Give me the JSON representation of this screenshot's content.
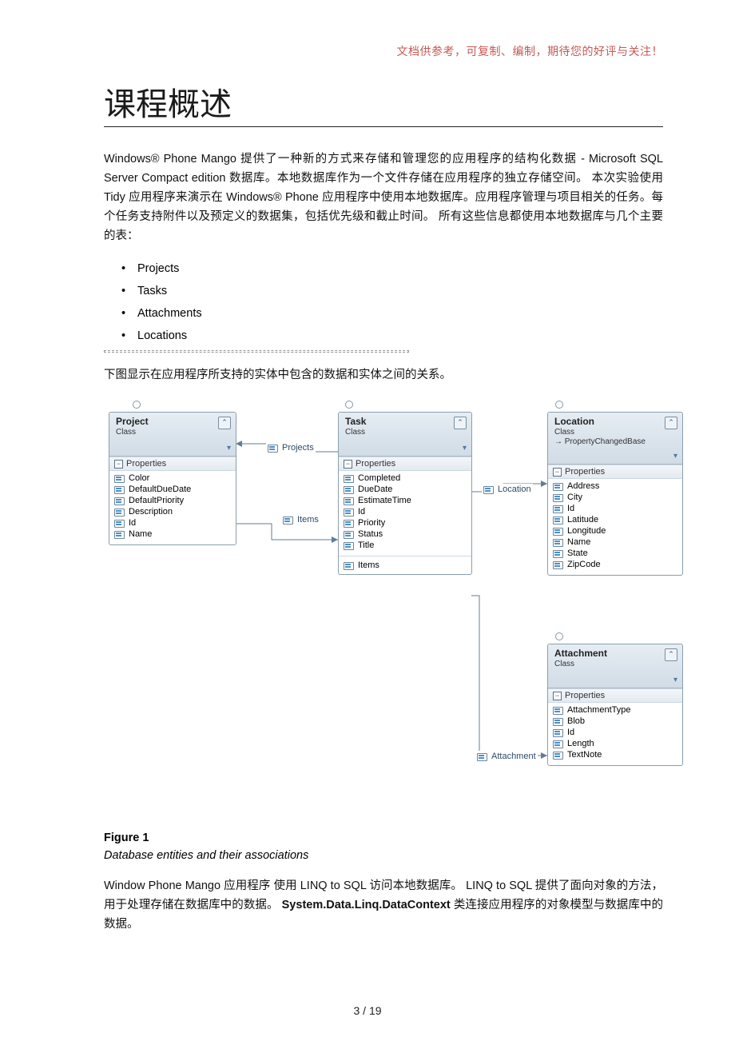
{
  "header_note": "文档供参考，可复制、编制，期待您的好评与关注！",
  "title": "课程概述",
  "intro_paragraph": "Windows® Phone Mango 提供了一种新的方式来存储和管理您的应用程序的结构化数据 - Microsoft SQL Server Compact edition 数据库。本地数据库作为一个文件存储在应用程序的独立存储空间。 本次实验使用 Tidy 应用程序来演示在 Windows® Phone 应用程序中使用本地数据库。应用程序管理与项目相关的任务。每个任务支持附件以及预定义的数据集，包括优先级和截止时间。 所有这些信息都使用本地数据库与几个主要的表：",
  "tables": [
    "Projects",
    "Tasks",
    "Attachments",
    "Locations"
  ],
  "pre_diagram_sentence": "下图显示在应用程序所支持的实体中包含的数据和实体之间的关系。",
  "figure": {
    "label": "Figure 1",
    "caption": "Database entities and their associations"
  },
  "closing_paragraph_parts": {
    "p1": "Window Phone Mango 应用程序 使用 LINQ to SQL 访问本地数据库。 LINQ to SQL 提供了面向对象的方法，用于处理存储在数据库中的数据。",
    "bold": "System.Data.Linq.DataContext",
    "p2": " 类连接应用程序的对象模型与数据库中的数据。"
  },
  "page_number": "3 / 19",
  "diagram": {
    "properties_label": "Properties",
    "class_label": "Class",
    "inherits_arrow": "→",
    "entities": {
      "project": {
        "name": "Project",
        "kind": "Class",
        "props": [
          "Color",
          "DefaultDueDate",
          "DefaultPriority",
          "Description",
          "Id",
          "Name"
        ]
      },
      "task": {
        "name": "Task",
        "kind": "Class",
        "props": [
          "Completed",
          "DueDate",
          "EstimateTime",
          "Id",
          "Priority",
          "Status",
          "Title"
        ],
        "assoc": "Items"
      },
      "location": {
        "name": "Location",
        "kind": "Class",
        "inherits": "PropertyChangedBase",
        "props": [
          "Address",
          "City",
          "Id",
          "Latitude",
          "Longitude",
          "Name",
          "State",
          "ZipCode"
        ]
      },
      "attachment": {
        "name": "Attachment",
        "kind": "Class",
        "props": [
          "AttachmentType",
          "Blob",
          "Id",
          "Length",
          "TextNote"
        ]
      }
    },
    "assoc_labels": {
      "projects": "Projects",
      "items": "Items",
      "location": "Location",
      "attachment": "Attachment"
    }
  }
}
